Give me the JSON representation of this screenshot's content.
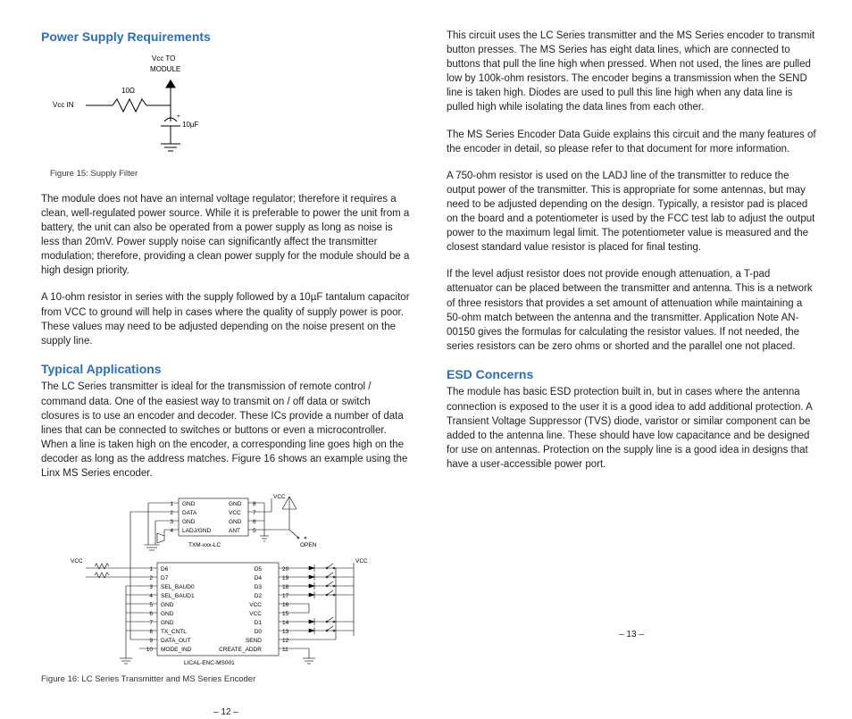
{
  "left": {
    "h1": "Power Supply Requirements",
    "p1": "The module does not have an internal voltage regulator; therefore it requires a clean, well-regulated power source. While it is preferable to power the unit from a battery, the unit can also be operated from a power supply as long as noise is less than 20mV. Power supply noise can significantly affect the transmitter modulation; therefore, providing a clean power supply for the module should be a high design priority.",
    "fig15": {
      "vcc_in": "Vcc IN",
      "vcc_to": "Vcc TO",
      "module": "MODULE",
      "r": "10Ω",
      "c": "10µF",
      "caption": "Figure 15: Supply Filter"
    },
    "p2": "A 10-ohm resistor in series with the supply followed by a 10µF tantalum capacitor from VCC to ground will help in cases where the quality of supply power is poor. These values may need to be adjusted depending on the noise present on the supply line.",
    "h2": "Typical Applications",
    "p3": "The LC Series transmitter is ideal for the transmission of remote control / command data. One of the easiest way to transmit on / off data or switch closures is to use an encoder and decoder. These ICs provide a number of data lines that can be connected to switches or buttons or even a microcontroller. When a line is taken high on the encoder, a corresponding line goes high on the decoder as long as the address matches. Figure 16 shows an example using the Linx MS Series encoder.",
    "fig16": {
      "txm_label": "TXM-xxx-LC",
      "enc_label": "LICAL-ENC-MS001",
      "caption": "Figure 16: LC Series Transmitter and MS Series Encoder",
      "txm_pins_left": [
        "GND",
        "DATA",
        "GND",
        "LADJ/GND"
      ],
      "txm_pins_right": [
        "GND",
        "VCC",
        "GND",
        "ANT"
      ],
      "enc_pins_left": [
        "D6",
        "D7",
        "SEL_BAUD0",
        "SEL_BAUD1",
        "GND",
        "GND",
        "GND",
        "TX_CNTL",
        "DATA_OUT",
        "MODE_IND"
      ],
      "enc_pins_right": [
        "D5",
        "D4",
        "D3",
        "D2",
        "VCC",
        "VCC",
        "D1",
        "D0",
        "SEND",
        "CREATE_ADDR"
      ]
    },
    "page": "– 12 –"
  },
  "right": {
    "p1": "This circuit uses the LC Series transmitter and the MS Series encoder to transmit button presses. The MS Series has eight data lines, which are connected to buttons that pull the line high when pressed. When not used, the lines are pulled low by 100k-ohm resistors. The encoder begins a transmission when the SEND line is taken high. Diodes are used to pull this line high when any data line is pulled high while isolating the data lines from each other.",
    "p2": "The MS Series Encoder Data Guide explains this circuit and the many features of the encoder in detail, so please refer to that document for more information.",
    "p3": "A 750-ohm resistor is used on the LADJ line of the transmitter to reduce the output power of the transmitter. This is appropriate for some antennas, but may need to be adjusted depending on the design. Typically, a resistor pad is placed on the board and a potentiometer is used by the FCC test lab to adjust the output power to the maximum legal limit. The potentiometer value is measured and the closest standard value resistor is placed for final testing.",
    "p4": "If the level adjust resistor does not provide enough attenuation, a T-pad attenuator can be placed between the transmitter and antenna. This is a network of three resistors that provides a set amount of attenuation while maintaining a 50-ohm match between the antenna and the transmitter. Application Note AN-00150 gives the formulas for calculating the resistor values. If not needed, the series resistors can be zero ohms or shorted and the parallel one not placed.",
    "h1": "ESD Concerns",
    "p5": "The module has basic ESD protection built in, but in cases where the antenna connection is exposed to the user it is a good idea to add additional protection. A Transient Voltage Suppressor (TVS) diode, varistor or similar component can be added to the antenna line. These should have low capacitance and be designed for use on antennas. Protection on the supply line is a good idea in designs that have a user-accessible power port.",
    "page": "– 13 –"
  }
}
